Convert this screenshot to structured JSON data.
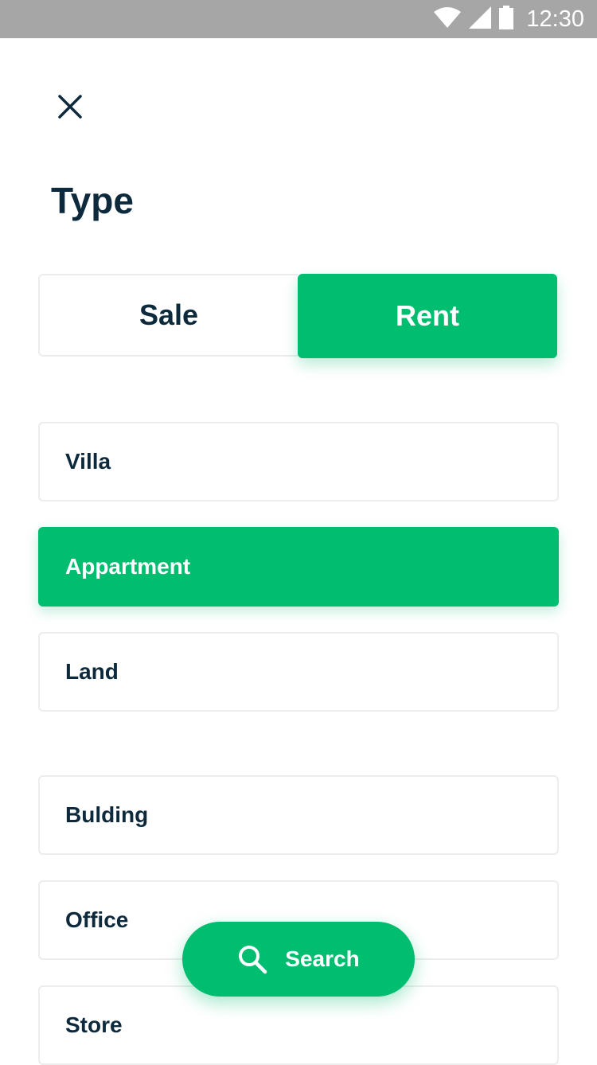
{
  "status_bar": {
    "time": "12:30",
    "icons": [
      "wifi-icon",
      "signal-icon",
      "battery-icon"
    ],
    "background": "#a6a6a6"
  },
  "header": {
    "close_icon": "close-icon",
    "title": "Type"
  },
  "listing_toggle": {
    "options": [
      {
        "label": "Sale",
        "selected": false
      },
      {
        "label": "Rent",
        "selected": true
      }
    ]
  },
  "property_types": [
    {
      "label": "Villa",
      "selected": false
    },
    {
      "label": "Appartment",
      "selected": true
    },
    {
      "label": "Land",
      "selected": false
    },
    {
      "label": "Bulding",
      "selected": false
    },
    {
      "label": "Office",
      "selected": false
    },
    {
      "label": "Store",
      "selected": false
    }
  ],
  "search_button": {
    "label": "Search",
    "icon": "search-icon"
  },
  "colors": {
    "accent": "#00bd6f",
    "text": "#0d2a3d",
    "border": "#ededed"
  }
}
